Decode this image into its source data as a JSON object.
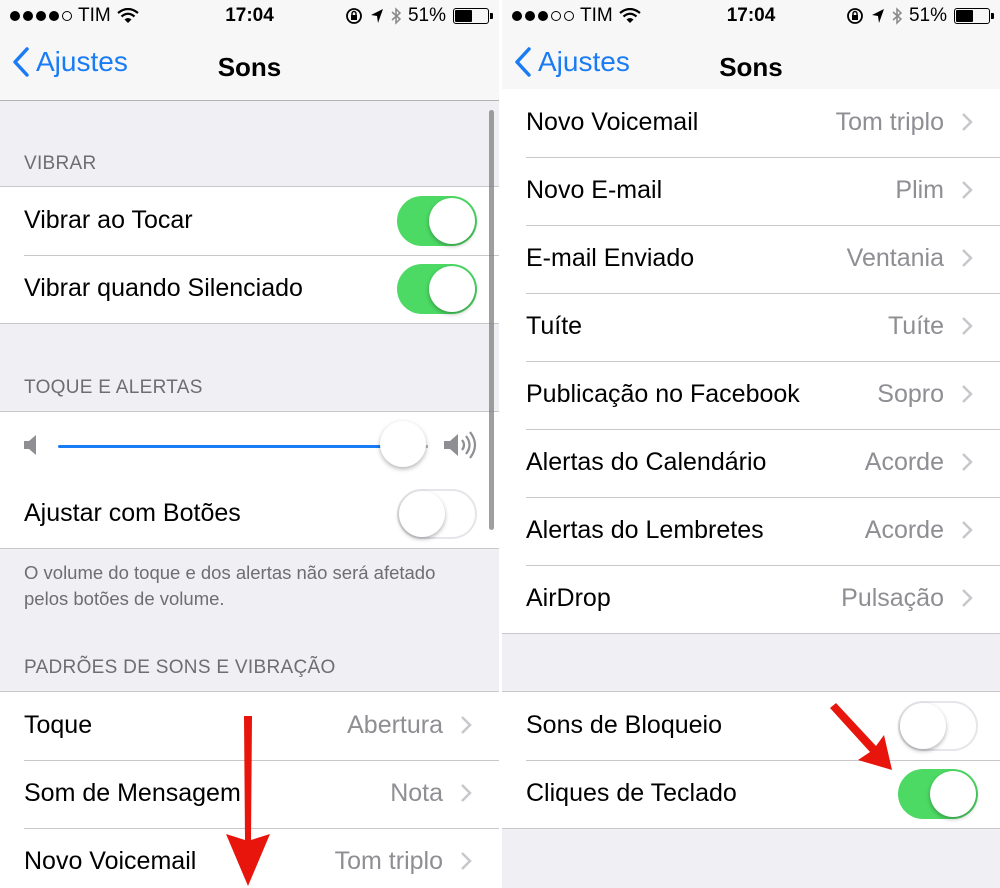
{
  "left": {
    "status": {
      "carrier": "TIM",
      "time": "17:04",
      "battery": "51%"
    },
    "nav": {
      "back_label": "Ajustes",
      "title": "Sons"
    },
    "vibrate": {
      "header": "VIBRAR",
      "items": [
        {
          "label": "Vibrar ao Tocar",
          "on": true
        },
        {
          "label": "Vibrar quando Silenciado",
          "on": true
        }
      ]
    },
    "ringer": {
      "header": "TOQUE E ALERTAS",
      "volume_level": 0.95,
      "adjust_label": "Ajustar com Botões",
      "adjust_on": false,
      "footer": "O volume do toque e dos alertas não será afetado pelos botões de volume."
    },
    "patterns": {
      "header": "PADRÕES DE SONS E VIBRAÇÃO",
      "items": [
        {
          "label": "Toque",
          "value": "Abertura"
        },
        {
          "label": "Som de Mensagem",
          "value": "Nota"
        },
        {
          "label": "Novo Voicemail",
          "value": "Tom triplo"
        }
      ]
    }
  },
  "right": {
    "status": {
      "carrier": "TIM",
      "time": "17:04",
      "battery": "51%"
    },
    "nav": {
      "back_label": "Ajustes",
      "title": "Sons"
    },
    "patterns": {
      "items": [
        {
          "label": "Novo Voicemail",
          "value": "Tom triplo"
        },
        {
          "label": "Novo E-mail",
          "value": "Plim"
        },
        {
          "label": "E-mail Enviado",
          "value": "Ventania"
        },
        {
          "label": "Tuíte",
          "value": "Tuíte"
        },
        {
          "label": "Publicação no Facebook",
          "value": "Sopro"
        },
        {
          "label": "Alertas do Calendário",
          "value": "Acorde"
        },
        {
          "label": "Alertas do Lembretes",
          "value": "Acorde"
        },
        {
          "label": "AirDrop",
          "value": "Pulsação"
        }
      ]
    },
    "other": {
      "items": [
        {
          "label": "Sons de Bloqueio",
          "on": false
        },
        {
          "label": "Cliques de Teclado",
          "on": true
        }
      ]
    }
  },
  "colors": {
    "accent": "#1a7cf5",
    "toggle_on": "#4cd964",
    "annotation": "#e8150c",
    "background": "#efeff4"
  }
}
